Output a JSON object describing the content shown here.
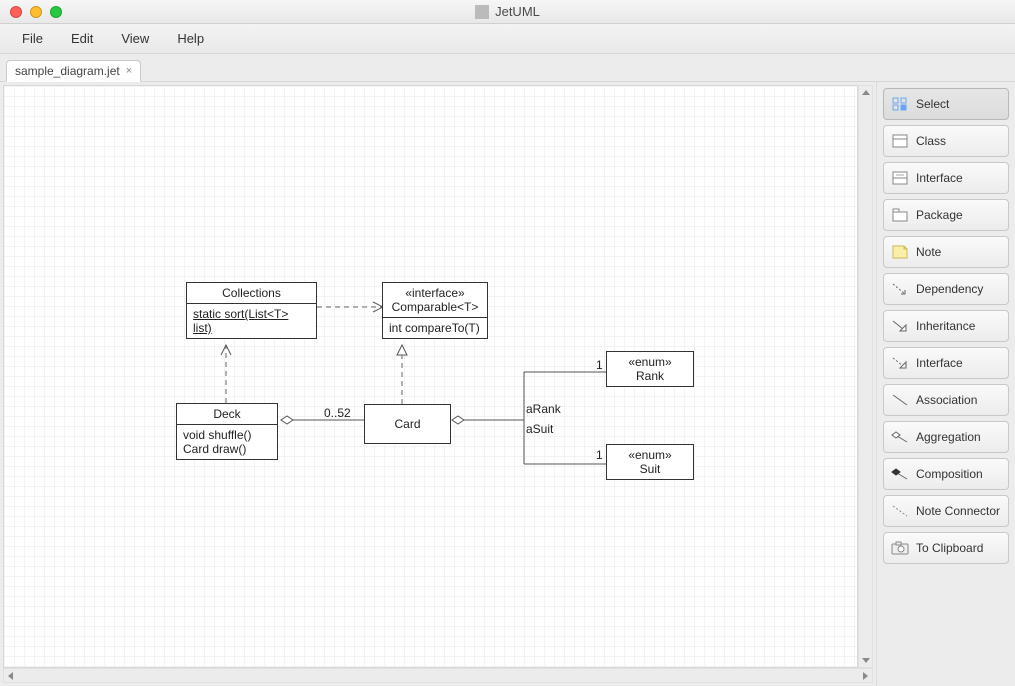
{
  "app": {
    "title": "JetUML"
  },
  "menu": {
    "file": "File",
    "edit": "Edit",
    "view": "View",
    "help": "Help"
  },
  "tab": {
    "name": "sample_diagram.jet",
    "close": "×"
  },
  "tools": {
    "select": "Select",
    "class": "Class",
    "interface": "Interface",
    "package": "Package",
    "note": "Note",
    "dependency": "Dependency",
    "inheritance": "Inheritance",
    "interfaceRel": "Interface",
    "association": "Association",
    "aggregation": "Aggregation",
    "composition": "Composition",
    "noteConnector": "Note Connector",
    "toClipboard": "To Clipboard"
  },
  "nodes": {
    "collections": {
      "name": "Collections",
      "method": "static sort(List<T> list)"
    },
    "comparable": {
      "stereo": "«interface»",
      "name": "Comparable<T>",
      "method": "int compareTo(T)"
    },
    "deck": {
      "name": "Deck",
      "m1": "void shuffle()",
      "m2": "Card draw()"
    },
    "card": {
      "name": "Card"
    },
    "rank": {
      "stereo": "«enum»",
      "name": "Rank"
    },
    "suit": {
      "stereo": "«enum»",
      "name": "Suit"
    }
  },
  "labels": {
    "mult_0_52": "0..52",
    "aRank": "aRank",
    "aSuit": "aSuit",
    "one_a": "1",
    "one_b": "1"
  }
}
